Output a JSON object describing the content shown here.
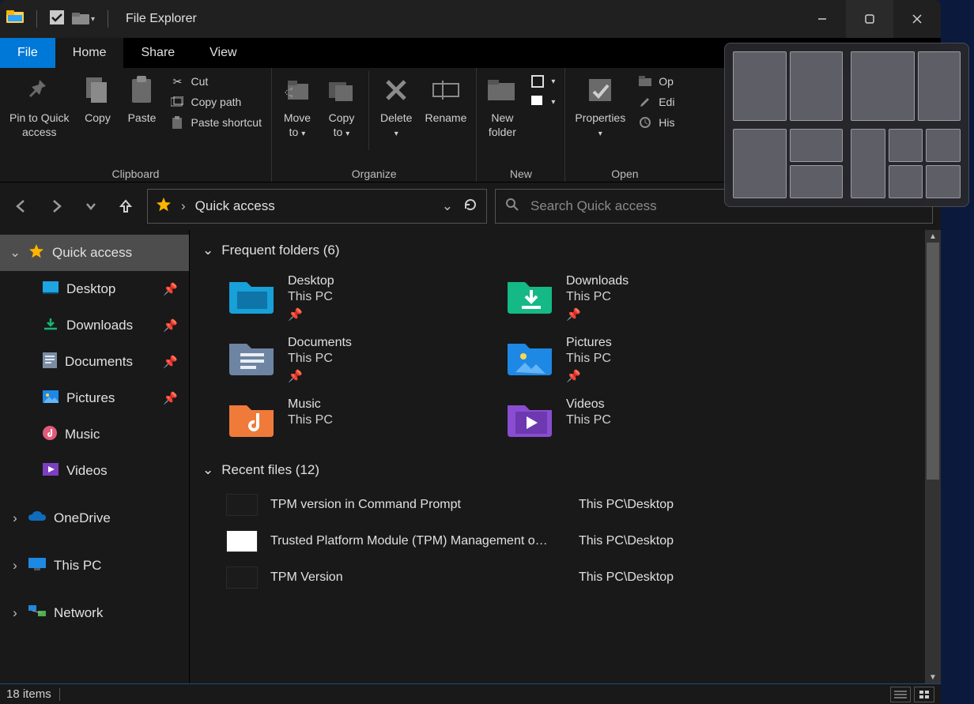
{
  "title": "File Explorer",
  "tabs": {
    "file": "File",
    "home": "Home",
    "share": "Share",
    "view": "View"
  },
  "ribbon": {
    "clipboard": {
      "label": "Clipboard",
      "pin": "Pin to Quick\naccess",
      "copy": "Copy",
      "paste": "Paste",
      "cut": "Cut",
      "copypath": "Copy path",
      "pasteshortcut": "Paste shortcut"
    },
    "organize": {
      "label": "Organize",
      "moveto": "Move\nto",
      "copyto": "Copy\nto",
      "delete": "Delete",
      "rename": "Rename"
    },
    "new": {
      "label": "New",
      "newfolder": "New\nfolder"
    },
    "open": {
      "label": "Open",
      "properties": "Properties",
      "open": "Op",
      "edit": "Edi",
      "history": "His"
    }
  },
  "breadcrumb": {
    "root": "Quick access"
  },
  "search": {
    "placeholder": "Search Quick access"
  },
  "sidebar": {
    "quick": "Quick access",
    "desktop": "Desktop",
    "downloads": "Downloads",
    "documents": "Documents",
    "pictures": "Pictures",
    "music": "Music",
    "videos": "Videos",
    "onedrive": "OneDrive",
    "thispc": "This PC",
    "network": "Network"
  },
  "sections": {
    "frequent": "Frequent folders (6)",
    "recent": "Recent files (12)"
  },
  "folders": [
    {
      "name": "Desktop",
      "sub": "This PC",
      "pinned": true,
      "color": "desktop"
    },
    {
      "name": "Downloads",
      "sub": "This PC",
      "pinned": true,
      "color": "downloads"
    },
    {
      "name": "Documents",
      "sub": "This PC",
      "pinned": true,
      "color": "documents"
    },
    {
      "name": "Pictures",
      "sub": "This PC",
      "pinned": true,
      "color": "pictures"
    },
    {
      "name": "Music",
      "sub": "This PC",
      "pinned": false,
      "color": "music"
    },
    {
      "name": "Videos",
      "sub": "This PC",
      "pinned": false,
      "color": "videos"
    }
  ],
  "recent": [
    {
      "name": "TPM version in Command Prompt",
      "path": "This PC\\Desktop",
      "thumb": "dark"
    },
    {
      "name": "Trusted Platform Module (TPM) Management o…",
      "path": "This PC\\Desktop",
      "thumb": "white"
    },
    {
      "name": "TPM Version",
      "path": "This PC\\Desktop",
      "thumb": "dark"
    }
  ],
  "status": {
    "count": "18 items"
  }
}
